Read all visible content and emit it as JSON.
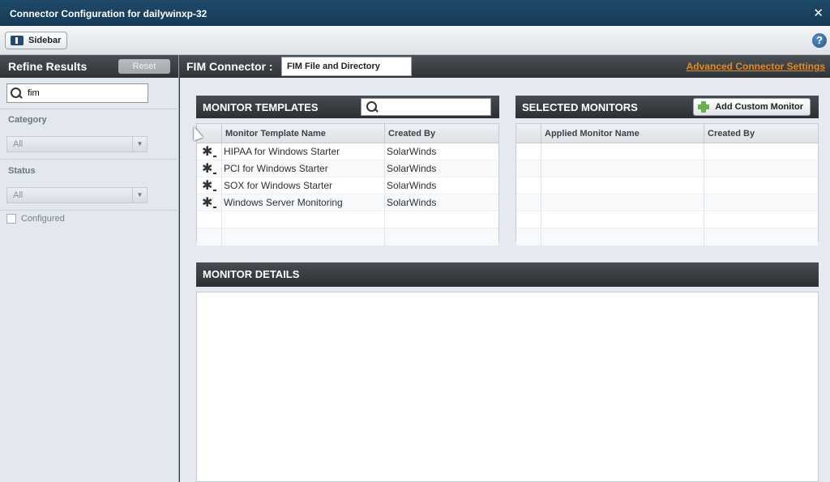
{
  "window": {
    "title": "Connector Configuration for dailywinxp-32",
    "close_icon": "close-icon"
  },
  "toolbar": {
    "sidebar_label": "Sidebar",
    "help_label": "?"
  },
  "sidebar": {
    "heading": "Refine Results",
    "reset_label": "Reset",
    "search_value": "fim",
    "category_label": "Category",
    "category_value": "All",
    "status_label": "Status",
    "status_value": "All",
    "configured_label": "Configured"
  },
  "connector": {
    "label": "FIM Connector :",
    "value": "FIM File and Directory",
    "advanced_link": "Advanced Connector Settings"
  },
  "templates": {
    "heading": "MONITOR TEMPLATES",
    "columns": [
      "Monitor Template Name",
      "Created By"
    ],
    "rows": [
      {
        "name": "HIPAA for Windows Starter",
        "created_by": "SolarWinds"
      },
      {
        "name": "PCI for Windows Starter",
        "created_by": "SolarWinds"
      },
      {
        "name": "SOX for Windows Starter",
        "created_by": "SolarWinds"
      },
      {
        "name": "Windows Server Monitoring",
        "created_by": "SolarWinds"
      }
    ]
  },
  "selected": {
    "heading": "SELECTED MONITORS",
    "add_label": "Add Custom Monitor",
    "columns": [
      "Applied Monitor Name",
      "Created By"
    ]
  },
  "details": {
    "heading": "MONITOR DETAILS"
  },
  "colors": {
    "accent_link": "#e28a2b",
    "title_bar": "#1f4a6a",
    "panel_header": "#2f3337"
  }
}
